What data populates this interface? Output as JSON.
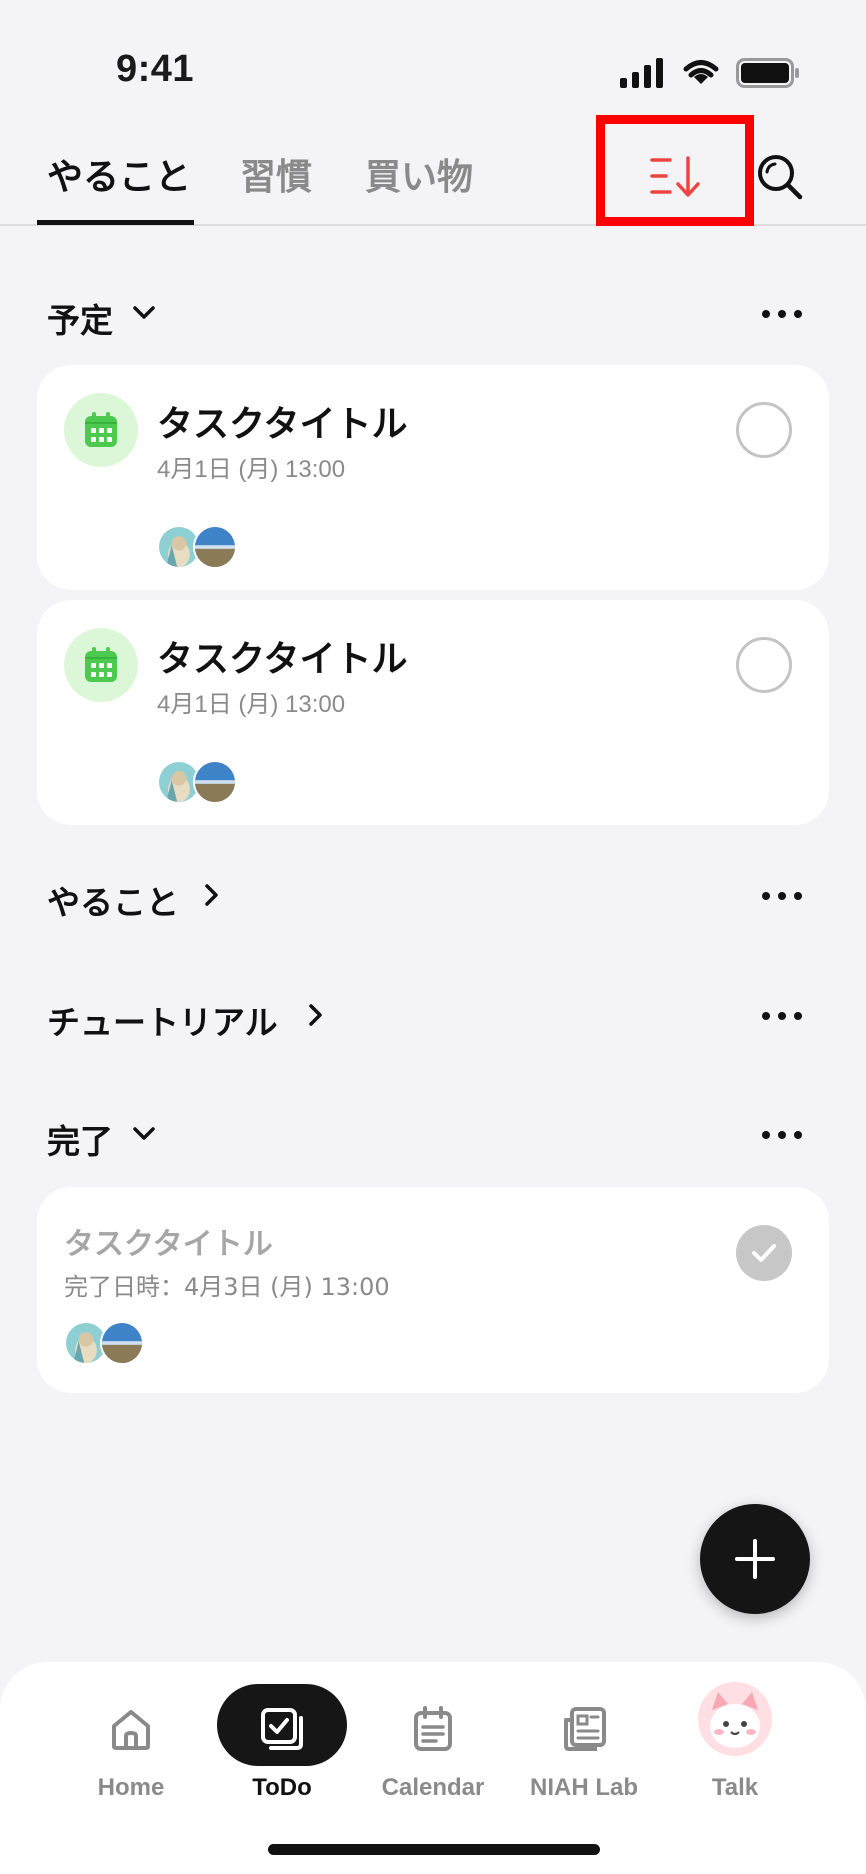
{
  "status_bar": {
    "time": "9:41",
    "icons": [
      "signal-icon",
      "wifi-icon",
      "battery-icon"
    ]
  },
  "tabs": [
    {
      "label": "やること",
      "active": true
    },
    {
      "label": "習慣",
      "active": false
    },
    {
      "label": "買い物",
      "active": false
    }
  ],
  "toolbar": {
    "sort_icon": "sort-descending-icon",
    "search_icon": "search-icon",
    "sort_color": "#ef4444",
    "highlight_color": "#ff0000"
  },
  "sections": {
    "scheduled": {
      "title": "予定",
      "expanded": true,
      "tasks": [
        {
          "title": "タスクタイトル",
          "date": "4月1日 (月) 13:00"
        },
        {
          "title": "タスクタイトル",
          "date": "4月1日 (月) 13:00"
        }
      ]
    },
    "todo": {
      "title": "やること",
      "expanded": false
    },
    "tutorial": {
      "title": "チュートリアル",
      "expanded": false
    },
    "completed": {
      "title": "完了",
      "expanded": true,
      "tasks": [
        {
          "title": "タスクタイトル",
          "date": "完了日時：4月3日 (月) 13:00"
        }
      ]
    }
  },
  "fab": {
    "icon": "plus-icon"
  },
  "bottom_nav": {
    "items": [
      {
        "label": "Home",
        "icon": "home-icon"
      },
      {
        "label": "ToDo",
        "icon": "todo-check-icon",
        "active": true
      },
      {
        "label": "Calendar",
        "icon": "calendar-doc-icon"
      },
      {
        "label": "NIAH Lab",
        "icon": "news-icon"
      },
      {
        "label": "Talk",
        "icon": "character-avatar"
      }
    ]
  },
  "colors": {
    "background": "#f4f3f5",
    "calendar_badge_bg": "#dcf7d7",
    "calendar_green": "#4cc94f",
    "active_pill": "#161616"
  }
}
